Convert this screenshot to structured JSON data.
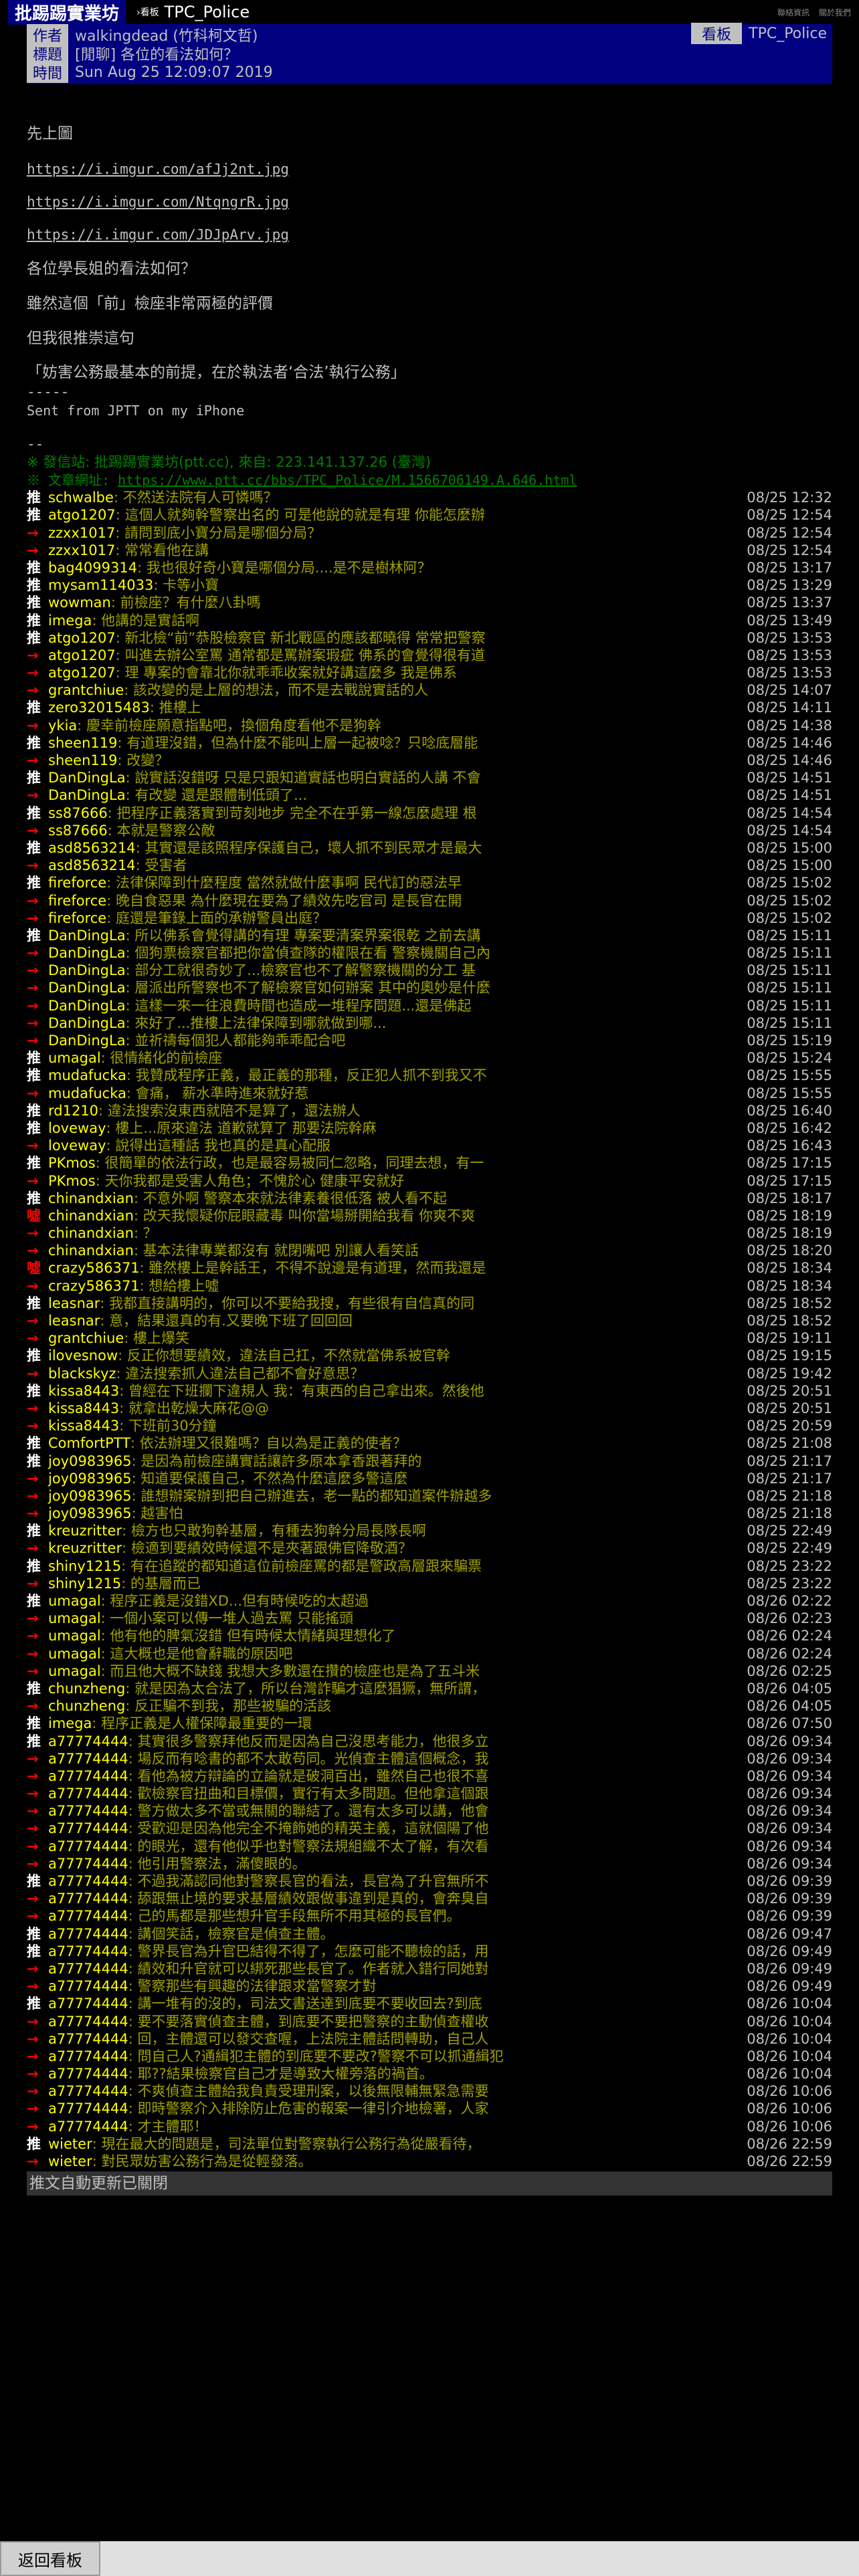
{
  "topbar": {
    "site": "批踢踢實業坊",
    "board_sep": "›看板",
    "board": "TPC_Police",
    "links": [
      "聯絡資訊",
      "關於我們"
    ]
  },
  "header": {
    "author_label": "作者",
    "author": "walkingdead (竹科柯文哲)",
    "board_label": "看板",
    "board": "TPC_Police",
    "title_label": "標題",
    "title": "[閒聊] 各位的看法如何？",
    "time_label": "時間",
    "time": "Sun Aug 25 12:09:07 2019"
  },
  "body": {
    "intro": "先上圖",
    "links": [
      "https://i.imgur.com/afJj2nt.jpg",
      "https://i.imgur.com/NtqngrR.jpg",
      "https://i.imgur.com/JDJpArv.jpg"
    ],
    "lines": [
      "各位學長姐的看法如何？",
      "雖然這個「前」檢座非常兩極的評價",
      "但我很推崇這句",
      "「妨害公務最基本的前提，在於執法者‘合法’執行公務」"
    ],
    "sig_sep": "-----",
    "sig": "Sent from JPTT on my iPhone",
    "sep2": "--",
    "origin": "※ 發信站: 批踢踢實業坊(ptt.cc), 來自: 223.141.137.26 (臺灣)",
    "url_label": "※ 文章網址: ",
    "url": "https://www.ptt.cc/bbs/TPC_Police/M.1566706149.A.646.html"
  },
  "pushes": [
    {
      "t": "推",
      "u": "schwalbe",
      "m": ": 不然送法院有人可憐嗎？",
      "d": "08/25 12:32"
    },
    {
      "t": "推",
      "u": "atgo1207",
      "m": ": 這個人就夠幹警察出名的 可是他說的就是有理 你能怎麼辦",
      "d": "08/25 12:54"
    },
    {
      "t": "→",
      "u": "zzxx1017",
      "m": ": 請問到底小寶分局是哪個分局？",
      "d": "08/25 12:54"
    },
    {
      "t": "→",
      "u": "zzxx1017",
      "m": ": 常常看他在講",
      "d": "08/25 12:54"
    },
    {
      "t": "推",
      "u": "bag4099314",
      "m": ": 我也很好奇小寶是哪個分局....是不是樹林阿？",
      "d": "08/25 13:17"
    },
    {
      "t": "推",
      "u": "mysam114033",
      "m": ": 卡等小寶",
      "d": "08/25 13:29"
    },
    {
      "t": "推",
      "u": "wowman",
      "m": ": 前檢座？有什麼八卦嗎",
      "d": "08/25 13:37"
    },
    {
      "t": "推",
      "u": "imega",
      "m": ": 他講的是實話啊",
      "d": "08/25 13:49"
    },
    {
      "t": "推",
      "u": "atgo1207",
      "m": ": 新北檢“前”恭股檢察官 新北戰區的應該都曉得 常常把警察",
      "d": "08/25 13:53"
    },
    {
      "t": "→",
      "u": "atgo1207",
      "m": ": 叫進去辦公室罵 通常都是罵辦案瑕疵 佛系的會覺得很有道",
      "d": "08/25 13:53"
    },
    {
      "t": "→",
      "u": "atgo1207",
      "m": ": 理 專案的會靠北你就乖乖收案就好講這麼多 我是佛系",
      "d": "08/25 13:53"
    },
    {
      "t": "→",
      "u": "grantchiue",
      "m": ": 該改變的是上層的想法，而不是去戰說實話的人",
      "d": "08/25 14:07"
    },
    {
      "t": "推",
      "u": "zero32015483",
      "m": ": 推樓上",
      "d": "08/25 14:11"
    },
    {
      "t": "→",
      "u": "ykia",
      "m": ": 慶幸前檢座願意指點吧，換個角度看他不是狗幹",
      "d": "08/25 14:38"
    },
    {
      "t": "推",
      "u": "sheen119",
      "m": ": 有道理沒錯，但為什麼不能叫上層一起被唸？只唸底層能",
      "d": "08/25 14:46"
    },
    {
      "t": "→",
      "u": "sheen119",
      "m": ": 改變？",
      "d": "08/25 14:46"
    },
    {
      "t": "推",
      "u": "DanDingLa",
      "m": ": 說實話沒錯呀 只是只跟知道實話也明白實話的人講 不會",
      "d": "08/25 14:51"
    },
    {
      "t": "→",
      "u": "DanDingLa",
      "m": ": 有改變 還是跟體制低頭了...",
      "d": "08/25 14:51"
    },
    {
      "t": "推",
      "u": "ss87666",
      "m": ": 把程序正義落實到苛刻地步 完全不在乎第一線怎麼處理 根",
      "d": "08/25 14:54"
    },
    {
      "t": "→",
      "u": "ss87666",
      "m": ": 本就是警察公敵",
      "d": "08/25 14:54"
    },
    {
      "t": "推",
      "u": "asd8563214",
      "m": ": 其實還是該照程序保護自己，壞人抓不到民眾才是最大",
      "d": "08/25 15:00"
    },
    {
      "t": "→",
      "u": "asd8563214",
      "m": ": 受害者",
      "d": "08/25 15:00"
    },
    {
      "t": "推",
      "u": "fireforce",
      "m": ": 法律保障到什麼程度 當然就做什麼事啊  民代訂的惡法早",
      "d": "08/25 15:02"
    },
    {
      "t": "→",
      "u": "fireforce",
      "m": ": 晚自食惡果 為什麼現在要為了績效先吃官司 是長官在開",
      "d": "08/25 15:02"
    },
    {
      "t": "→",
      "u": "fireforce",
      "m": ": 庭還是筆錄上面的承辦警員出庭？",
      "d": "08/25 15:02"
    },
    {
      "t": "推",
      "u": "DanDingLa",
      "m": ": 所以佛系會覺得講的有理 專案要清案界案很乾 之前去講",
      "d": "08/25 15:11"
    },
    {
      "t": "→",
      "u": "DanDingLa",
      "m": ": 個狗票檢察官都把你當偵查隊的權限在看 警察機關自己內",
      "d": "08/25 15:11"
    },
    {
      "t": "→",
      "u": "DanDingLa",
      "m": ": 部分工就很奇妙了...檢察官也不了解警察機關的分工 基",
      "d": "08/25 15:11"
    },
    {
      "t": "→",
      "u": "DanDingLa",
      "m": ": 層派出所警察也不了解檢察官如何辦案 其中的奧妙是什麼",
      "d": "08/25 15:11"
    },
    {
      "t": "→",
      "u": "DanDingLa",
      "m": ": 這樣一來一往浪費時間也造成一堆程序問題...還是佛起",
      "d": "08/25 15:11"
    },
    {
      "t": "→",
      "u": "DanDingLa",
      "m": ": 來好了...推樓上法律保障到哪就做到哪...",
      "d": "08/25 15:11"
    },
    {
      "t": "→",
      "u": "DanDingLa",
      "m": ": 並祈禱每個犯人都能夠乖乖配合吧",
      "d": "08/25 15:19"
    },
    {
      "t": "推",
      "u": "umagal",
      "m": ": 很情緒化的前檢座",
      "d": "08/25 15:24"
    },
    {
      "t": "推",
      "u": "mudafucka",
      "m": ": 我贊成程序正義，最正義的那種，反正犯人抓不到我又不",
      "d": "08/25 15:55"
    },
    {
      "t": "→",
      "u": "mudafucka",
      "m": ": 會痛， 薪水準時進來就好惹",
      "d": "08/25 15:55"
    },
    {
      "t": "推",
      "u": "rd1210",
      "m": ": 違法搜索沒東西就陪不是算了，還法辦人",
      "d": "08/25 16:40"
    },
    {
      "t": "推",
      "u": "loveway",
      "m": ": 樓上...原來違法 道歉就算了 那要法院幹麻",
      "d": "08/25 16:42"
    },
    {
      "t": "→",
      "u": "loveway",
      "m": ": 說得出這種話 我也真的是真心配服",
      "d": "08/25 16:43"
    },
    {
      "t": "推",
      "u": "PKmos",
      "m": ": 很簡單的依法行政，也是最容易被同仁忽略，同理去想，有一",
      "d": "08/25 17:15"
    },
    {
      "t": "→",
      "u": "PKmos",
      "m": ": 天你我都是受害人角色；不愧於心 健康平安就好",
      "d": "08/25 17:15"
    },
    {
      "t": "推",
      "u": "chinandxian",
      "m": ": 不意外啊 警察本來就法律素養很低落 被人看不起",
      "d": "08/25 18:17"
    },
    {
      "t": "噓",
      "u": "chinandxian",
      "m": ": 改天我懷疑你屁眼藏毒 叫你當場掰開給我看 你爽不爽",
      "d": "08/25 18:19"
    },
    {
      "t": "→",
      "u": "chinandxian",
      "m": ": ？",
      "d": "08/25 18:19"
    },
    {
      "t": "→",
      "u": "chinandxian",
      "m": ": 基本法律專業都沒有 就閉嘴吧 別讓人看笑話",
      "d": "08/25 18:20"
    },
    {
      "t": "噓",
      "u": "crazy586371",
      "m": ": 雖然樓上是幹話王，不得不說邊是有道理，然而我還是",
      "d": "08/25 18:34"
    },
    {
      "t": "→",
      "u": "crazy586371",
      "m": ": 想給樓上噓",
      "d": "08/25 18:34"
    },
    {
      "t": "推",
      "u": "leasnar",
      "m": ": 我都直接講明的，你可以不要給我搜，有些很有自信真的同",
      "d": "08/25 18:52"
    },
    {
      "t": "→",
      "u": "leasnar",
      "m": ": 意，結果還真的有.又要晚下班了回回回",
      "d": "08/25 18:52"
    },
    {
      "t": "→",
      "u": "grantchiue",
      "m": ": 樓上爆笑",
      "d": "08/25 19:11"
    },
    {
      "t": "推",
      "u": "ilovesnow",
      "m": ": 反正你想要績效，違法自己扛，不然就當佛系被官幹",
      "d": "08/25 19:15"
    },
    {
      "t": "→",
      "u": "blackskyz",
      "m": ": 違法搜索抓人違法自己都不會好意思？",
      "d": "08/25 19:42"
    },
    {
      "t": "推",
      "u": "kissa8443",
      "m": ": 曾經在下班攔下違規人 我：有東西的自己拿出來。然後他",
      "d": "08/25 20:51"
    },
    {
      "t": "→",
      "u": "kissa8443",
      "m": ": 就拿出乾燥大麻花@@",
      "d": "08/25 20:51"
    },
    {
      "t": "→",
      "u": "kissa8443",
      "m": ": 下班前30分鐘",
      "d": "08/25 20:59"
    },
    {
      "t": "推",
      "u": "ComfortPTT",
      "m": ": 依法辦理又很難嗎？自以為是正義的使者？",
      "d": "08/25 21:08"
    },
    {
      "t": "推",
      "u": "joy0983965",
      "m": ": 是因為前檢座講實話讓許多原本拿香跟著拜的",
      "d": "08/25 21:17"
    },
    {
      "t": "→",
      "u": "joy0983965",
      "m": ": 知道要保護自己，不然為什麼這麼多警這麼",
      "d": "08/25 21:17"
    },
    {
      "t": "→",
      "u": "joy0983965",
      "m": ": 誰想辦案辦到把自己辦進去，老一點的都知道案件辦越多",
      "d": "08/25 21:18"
    },
    {
      "t": "→",
      "u": "joy0983965",
      "m": ": 越害怕",
      "d": "08/25 21:18"
    },
    {
      "t": "推",
      "u": "kreuzritter",
      "m": ": 檢方也只敢狗幹基層，有種去狗幹分局長隊長啊",
      "d": "08/25 22:49"
    },
    {
      "t": "→",
      "u": "kreuzritter",
      "m": ": 檢適到要績效時候還不是夾著跟佛官降敬酒？",
      "d": "08/25 22:49"
    },
    {
      "t": "推",
      "u": "shiny1215",
      "m": ": 有在追蹤的都知道這位前檢座罵的都是警政高層跟來騙票",
      "d": "08/25 23:22"
    },
    {
      "t": "→",
      "u": "shiny1215",
      "m": ": 的基層而已",
      "d": "08/25 23:22"
    },
    {
      "t": "推",
      "u": "umagal",
      "m": ": 程序正義是沒錯XD...但有時候吃的太超過",
      "d": "08/26 02:22"
    },
    {
      "t": "→",
      "u": "umagal",
      "m": ": 一個小案可以傳一堆人過去罵 只能搖頭",
      "d": "08/26 02:23"
    },
    {
      "t": "→",
      "u": "umagal",
      "m": ": 他有他的脾氣沒錯 但有時候太情緒與理想化了",
      "d": "08/26 02:24"
    },
    {
      "t": "→",
      "u": "umagal",
      "m": ": 這大概也是他會辭職的原因吧",
      "d": "08/26 02:24"
    },
    {
      "t": "→",
      "u": "umagal",
      "m": ": 而且他大概不缺錢 我想大多數還在攢的檢座也是為了五斗米",
      "d": "08/26 02:25"
    },
    {
      "t": "推",
      "u": "chunzheng",
      "m": ": 就是因為太合法了，所以台灣詐騙才這麼猖獗，無所謂，",
      "d": "08/26 04:05"
    },
    {
      "t": "→",
      "u": "chunzheng",
      "m": ": 反正騙不到我，那些被騙的活該",
      "d": "08/26 04:05"
    },
    {
      "t": "推",
      "u": "imega",
      "m": ": 程序正義是人權保障最重要的一環",
      "d": "08/26 07:50"
    },
    {
      "t": "推",
      "u": "a77774444",
      "m": ": 其實很多警察拜他反而是因為自己沒思考能力，他很多立",
      "d": "08/26 09:34"
    },
    {
      "t": "→",
      "u": "a77774444",
      "m": ": 場反而有唸書的都不太敢苟同。光偵查主體這個概念，我",
      "d": "08/26 09:34"
    },
    {
      "t": "→",
      "u": "a77774444",
      "m": ": 看他為被方辯論的立論就是破洞百出，雖然自己也很不喜",
      "d": "08/26 09:34"
    },
    {
      "t": "→",
      "u": "a77774444",
      "m": ": 歡檢察官扭曲和目標價，實行有太多問題。但他拿這個跟",
      "d": "08/26 09:34"
    },
    {
      "t": "→",
      "u": "a77774444",
      "m": ": 警方做太多不當或無關的聯結了。還有太多可以講，他會",
      "d": "08/26 09:34"
    },
    {
      "t": "→",
      "u": "a77774444",
      "m": ": 受歡迎是因為他完全不掩飾她的精英主義，這就個陽了他",
      "d": "08/26 09:34"
    },
    {
      "t": "→",
      "u": "a77774444",
      "m": ": 的眼光，還有他似乎也對警察法規組織不太了解，有次看",
      "d": "08/26 09:34"
    },
    {
      "t": "→",
      "u": "a77774444",
      "m": ": 他引用警察法，滿傻眼的。",
      "d": "08/26 09:34"
    },
    {
      "t": "推",
      "u": "a77774444",
      "m": ": 不過我滿認同他對警察長官的看法，長官為了升官無所不",
      "d": "08/26 09:39"
    },
    {
      "t": "→",
      "u": "a77774444",
      "m": ": 舔跟無止境的要求基層績效跟做事違到是真的，會奔臭自",
      "d": "08/26 09:39"
    },
    {
      "t": "→",
      "u": "a77774444",
      "m": ": 己的馬都是那些想升官手段無所不用其極的長官們。",
      "d": "08/26 09:39"
    },
    {
      "t": "推",
      "u": "a77774444",
      "m": ": 講個笑話，檢察官是偵查主體。",
      "d": "08/26 09:47"
    },
    {
      "t": "推",
      "u": "a77774444",
      "m": ": 警界長官為升官巴結得不得了，怎麼可能不聽檢的話，用",
      "d": "08/26 09:49"
    },
    {
      "t": "→",
      "u": "a77774444",
      "m": ": 績效和升官就可以綁死那些長官了。作者就入錯行同她對",
      "d": "08/26 09:49"
    },
    {
      "t": "→",
      "u": "a77774444",
      "m": ": 警察那些有興趣的法律跟求當警察才對",
      "d": "08/26 09:49"
    },
    {
      "t": "推",
      "u": "a77774444",
      "m": ": 講一堆有的沒的，司法文書送達到底要不要收回去?到底",
      "d": "08/26 10:04"
    },
    {
      "t": "→",
      "u": "a77774444",
      "m": ": 要不要落實偵查主體，到底要不要把警察的主動偵查權收",
      "d": "08/26 10:04"
    },
    {
      "t": "→",
      "u": "a77774444",
      "m": ": 回，主體還可以發交查喔，上法院主體話問轉助，自己人",
      "d": "08/26 10:04"
    },
    {
      "t": "→",
      "u": "a77774444",
      "m": ": 問自己人?通緝犯主體的到底要不要改?警察不可以抓通緝犯",
      "d": "08/26 10:04"
    },
    {
      "t": "→",
      "u": "a77774444",
      "m": ": 耶??結果檢察官自己才是導致大權旁落的禍首。",
      "d": "08/26 10:04"
    },
    {
      "t": "→",
      "u": "a77774444",
      "m": ": 不爽偵查主體給我負責受理刑案，以後無限輔無緊急需要",
      "d": "08/26 10:06"
    },
    {
      "t": "→",
      "u": "a77774444",
      "m": ": 即時警察介入排除防止危害的報案一律引介地檢署，人家",
      "d": "08/26 10:06"
    },
    {
      "t": "→",
      "u": "a77774444",
      "m": ": 才主體耶！",
      "d": "08/26 10:06"
    },
    {
      "t": "推",
      "u": "wieter",
      "m": ": 現在最大的問題是，司法單位對警察執行公務行為從嚴看待，",
      "d": "08/26 22:59"
    },
    {
      "t": "→",
      "u": "wieter",
      "m": ": 對民眾妨害公務行為是從輕發落。",
      "d": "08/26 22:59"
    }
  ],
  "autoupdate": "推文自動更新已關閉",
  "footer": {
    "back_label": "返回看板"
  }
}
